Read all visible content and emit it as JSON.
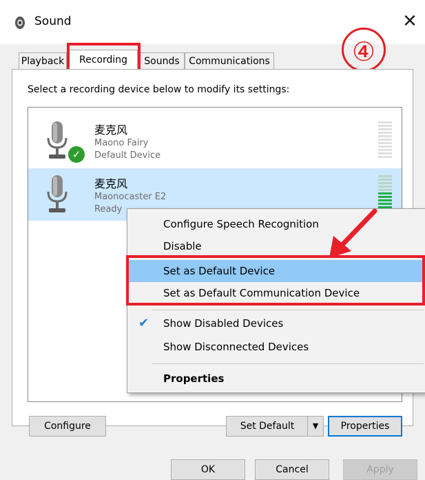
{
  "window": {
    "title": "Sound",
    "close_glyph": "✕"
  },
  "step_badge": "④",
  "tabs": [
    {
      "label": "Playback"
    },
    {
      "label": "Recording"
    },
    {
      "label": "Sounds"
    },
    {
      "label": "Communications"
    }
  ],
  "instruction": "Select a recording device below to modify its settings:",
  "devices": [
    {
      "name": "麦克风",
      "model": "Maono Fairy",
      "status": "Default Device",
      "icon": "microphone-icon",
      "badge_icon": "green-check-icon"
    },
    {
      "name": "麦克风",
      "model": "Maonocaster E2",
      "status": "Ready",
      "icon": "microphone-icon"
    }
  ],
  "context_menu": {
    "items": [
      {
        "label": "Configure Speech Recognition"
      },
      {
        "label": "Disable"
      },
      {
        "label": "Set as Default Device"
      },
      {
        "label": "Set as Default Communication Device"
      },
      {
        "label": "Show Disabled Devices",
        "checked": true
      },
      {
        "label": "Show Disconnected Devices"
      },
      {
        "label": "Properties"
      }
    ]
  },
  "buttons": {
    "configure": "Configure",
    "set_default": "Set Default",
    "properties": "Properties",
    "ok": "OK",
    "cancel": "Cancel",
    "apply": "Apply"
  },
  "colors": {
    "annotation_red": "#e8202a",
    "selection_blue": "#cce8ff",
    "menu_highlight": "#91c9f7",
    "level_green": "#22b14c"
  }
}
